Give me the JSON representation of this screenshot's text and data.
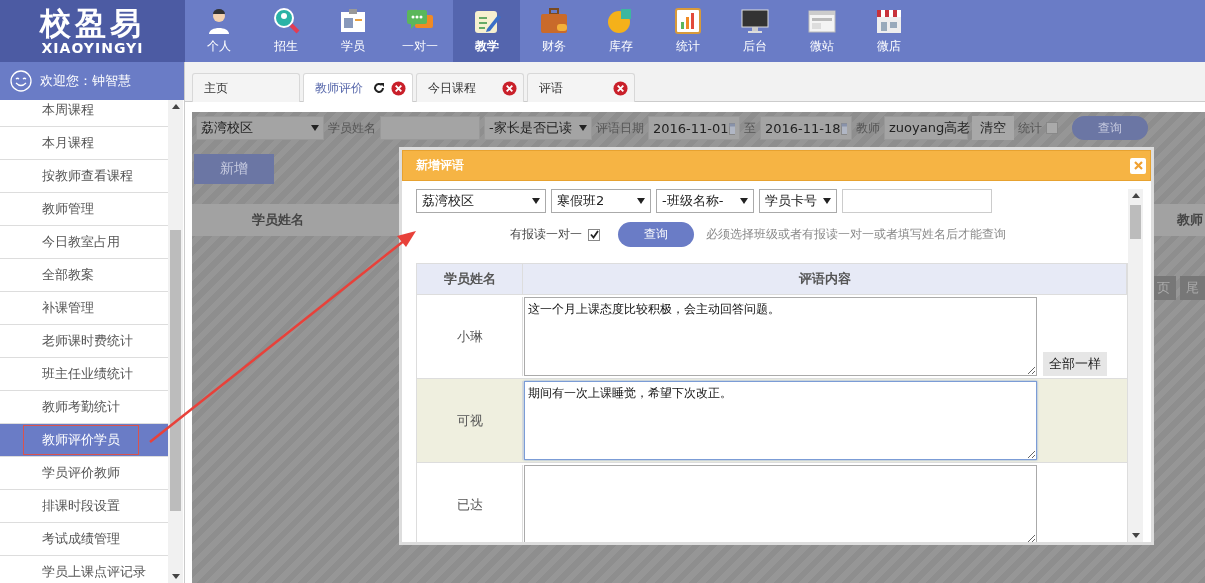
{
  "logo": {
    "title": "校盈易",
    "subtitle": "XIAOYINGYI"
  },
  "nav": [
    {
      "label": "个人",
      "kind": "person",
      "selected": false
    },
    {
      "label": "招生",
      "kind": "search",
      "selected": false
    },
    {
      "label": "学员",
      "kind": "card",
      "selected": false
    },
    {
      "label": "一对一",
      "kind": "chat",
      "selected": false
    },
    {
      "label": "教学",
      "kind": "edit",
      "selected": true
    },
    {
      "label": "财务",
      "kind": "briefcase",
      "selected": false
    },
    {
      "label": "库存",
      "kind": "pie",
      "selected": false
    },
    {
      "label": "统计",
      "kind": "chart",
      "selected": false
    },
    {
      "label": "后台",
      "kind": "monitor",
      "selected": false
    },
    {
      "label": "微站",
      "kind": "web",
      "selected": false
    },
    {
      "label": "微店",
      "kind": "store",
      "selected": false
    }
  ],
  "welcome": "欢迎您：钟智慧",
  "sidebar": {
    "items": [
      {
        "label": "本周课程",
        "selected": false
      },
      {
        "label": "本月课程",
        "selected": false
      },
      {
        "label": "按教师查看课程",
        "selected": false
      },
      {
        "label": "教师管理",
        "selected": false
      },
      {
        "label": "今日教室占用",
        "selected": false
      },
      {
        "label": "全部教案",
        "selected": false
      },
      {
        "label": "补课管理",
        "selected": false
      },
      {
        "label": "老师课时费统计",
        "selected": false
      },
      {
        "label": "班主任业绩统计",
        "selected": false
      },
      {
        "label": "教师考勤统计",
        "selected": false
      },
      {
        "label": "教师评价学员",
        "selected": true
      },
      {
        "label": "学员评价教师",
        "selected": false
      },
      {
        "label": "排课时段设置",
        "selected": false
      },
      {
        "label": "考试成绩管理",
        "selected": false
      },
      {
        "label": "学员上课点评记录",
        "selected": false
      }
    ]
  },
  "tabs": [
    {
      "label": "主页",
      "selected": false,
      "closable": false,
      "refresh": false
    },
    {
      "label": "教师评价",
      "selected": true,
      "closable": true,
      "refresh": true
    },
    {
      "label": "今日课程",
      "selected": false,
      "closable": true,
      "refresh": false
    },
    {
      "label": "评语",
      "selected": false,
      "closable": true,
      "refresh": false
    }
  ],
  "filter": {
    "campus": "荔湾校区",
    "student_name_label": "学员姓名",
    "parent_read": "-家长是否已读",
    "date_label": "评语日期",
    "date_from": "2016-11-01",
    "to_label": "至",
    "date_to": "2016-11-18",
    "teacher_label": "教师",
    "teacher": "zuoyang高老",
    "clear": "清空",
    "stats_label": "统计",
    "stats_checked": false,
    "query": "查询"
  },
  "add_button": "新增",
  "table": {
    "columns": [
      "学员姓名",
      "教师"
    ]
  },
  "pager": [
    "页",
    "尾"
  ],
  "dialog": {
    "title": "新增评语",
    "campus": "荔湾校区",
    "class_type": "寒假班2",
    "class_name": "-班级名称-",
    "search_by": "学员卡号",
    "one_on_one_label": "有报读一对一",
    "one_on_one_checked": true,
    "query": "查询",
    "hint": "必须选择班级或者有报读一对一或者填写姓名后才能查询",
    "columns": [
      "学员姓名",
      "评语内容"
    ],
    "rows": [
      {
        "name": "小琳",
        "comment": "这一个月上课态度比较积极，会主动回答问题。",
        "focused": false,
        "highlighted": false,
        "copy_all": "全部一样"
      },
      {
        "name": "可视",
        "comment": "期间有一次上课睡觉，希望下次改正。",
        "focused": true,
        "highlighted": true
      },
      {
        "name": "已达",
        "focused": false,
        "highlighted": false
      }
    ]
  }
}
